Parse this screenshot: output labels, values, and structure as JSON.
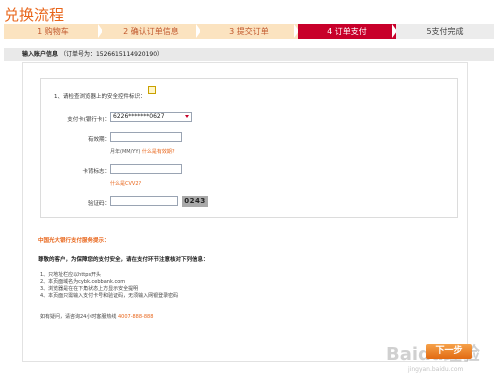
{
  "page_title": "兑换流程",
  "steps": [
    {
      "label": "1 购物车",
      "state": "done"
    },
    {
      "label": "2 确认订单信息",
      "state": "done"
    },
    {
      "label": "3 提交订单",
      "state": "done"
    },
    {
      "label": "4 订单支付",
      "state": "active"
    },
    {
      "label": "5支付完成",
      "state": "todo"
    }
  ],
  "info_bar": {
    "title": "输入账户信息",
    "order_label": "（订单号为：",
    "order_no": "1526615114920190",
    "order_end": "）"
  },
  "form": {
    "tip": "1、请检查浏览器上的安全控件标识：",
    "card_label": "支付卡(银行卡)：",
    "card_value": "6226*******0627",
    "expiry_label": "有效期：",
    "expiry_value": "",
    "expiry_hint": "月年(MM/YY)",
    "expiry_link": "什么是有效期?",
    "cvv_label": "卡背标志：",
    "cvv_value": "",
    "cvv_link": "什么是CVV2?",
    "captcha_label": "验证码：",
    "captcha_value": "",
    "captcha_image": "0243"
  },
  "security": {
    "title": "中国光大银行支付服务提示：",
    "subtitle": "尊敬的客户，为保障您的支付安全，请在支付环节注意核对下列信息：",
    "items": [
      "1、只地址栏应以https开头",
      "2、本页面域名为cybk.cebbank.com",
      "3、浏览器是在在下角状态上方显示安全提明",
      "4、本页面只需输入支付卡号和验证码，无须输入网银登录密码"
    ],
    "contact_prefix": "如有疑问，请咨询24小时客服热线",
    "contact_phone": "4007-888-888"
  },
  "next_button": "下一步",
  "watermark": "Baidu经验",
  "watermark_sub": "jingyan.baidu.com"
}
